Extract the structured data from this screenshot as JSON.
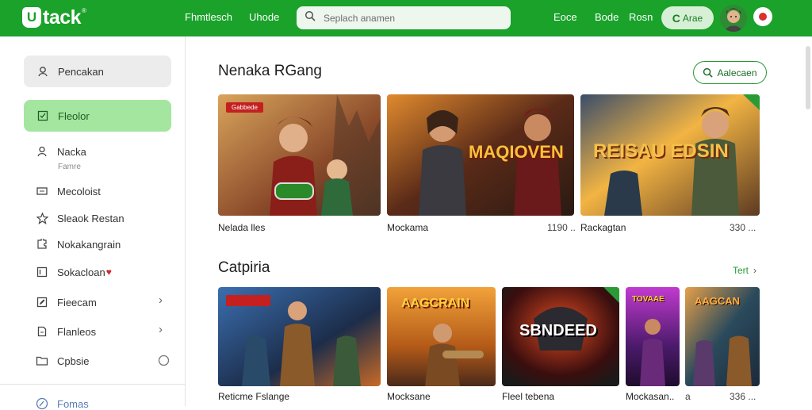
{
  "header": {
    "logo_text": "tack",
    "logo_mark": "U",
    "logo_reg": "®",
    "nav": [
      "Fhmtlesch",
      "Uhode"
    ],
    "search_placeholder": "Seplach anamen",
    "links": [
      "Eoce",
      "Bode",
      "Rosn"
    ],
    "cta_label": "Arae",
    "cta_glyph": "C",
    "accent": "#1aa22a"
  },
  "sidebar": {
    "search_label": "Pencakan",
    "active_label": "Fleolor",
    "items": [
      {
        "label": "Nacka",
        "sub": "Famre",
        "icon": "user-icon"
      },
      {
        "label": "Mecoloist",
        "icon": "monitor-icon"
      },
      {
        "label": "Sleaok Restan",
        "icon": "star-icon"
      },
      {
        "label": "Nokakangrain",
        "icon": "puzzle-icon"
      },
      {
        "label": "Sokacloan",
        "icon": "square-icon"
      },
      {
        "label": "Fieecam",
        "icon": "edit-icon"
      },
      {
        "label": "Flanleos",
        "icon": "file-icon"
      },
      {
        "label": "Cpbsie",
        "icon": "folder-icon"
      },
      {
        "label": "Fomas",
        "icon": "settings-icon"
      }
    ]
  },
  "featured": {
    "title": "Nenaka RGang",
    "button_label": "Aalecaen",
    "cards": [
      {
        "caption": "Nelada lles",
        "badge": "Gabbede",
        "art_title": "",
        "number": "",
        "colors": [
          "#8a4a2a",
          "#d9a45c",
          "#3b2a1f"
        ]
      },
      {
        "caption": "Mockama",
        "badge": "",
        "art_title": "MAQIOVEN",
        "number": "1190 ..",
        "colors": [
          "#5a2a18",
          "#e08a2e",
          "#2a1a12"
        ]
      },
      {
        "caption": "Rackagtan",
        "badge": "",
        "art_title": "REISAU EDSIN",
        "number": "330 ...",
        "colors": [
          "#5c3a22",
          "#f2b443",
          "#3a4d6a"
        ]
      }
    ]
  },
  "categories": {
    "title": "Catpiria",
    "see_all": "Tert",
    "cards": [
      {
        "caption": "Reticme Fslange",
        "art_title": "",
        "number": "",
        "colors": [
          "#1c2d4a",
          "#3b6fb0",
          "#c86a26"
        ]
      },
      {
        "caption": "Mocksane",
        "art_title": "AAGCRAIN",
        "number": "",
        "colors": [
          "#b35a18",
          "#f2a23a",
          "#4a2a1a"
        ]
      },
      {
        "caption": "Fleel tebena",
        "art_title": "SBNDEED",
        "number": "",
        "colors": [
          "#3a0e0e",
          "#e04a22",
          "#1a1a1a"
        ]
      },
      {
        "caption": "Mockasan..",
        "art_title": "TOVAAE",
        "number": "a",
        "colors": [
          "#4a1a6a",
          "#c13ad0",
          "#1f0c2e"
        ]
      },
      {
        "caption": "",
        "art_title": "AAGCAN",
        "number": "336 ...",
        "colors": [
          "#2a4a5c",
          "#e6a04a",
          "#1c2a3a"
        ]
      }
    ]
  }
}
